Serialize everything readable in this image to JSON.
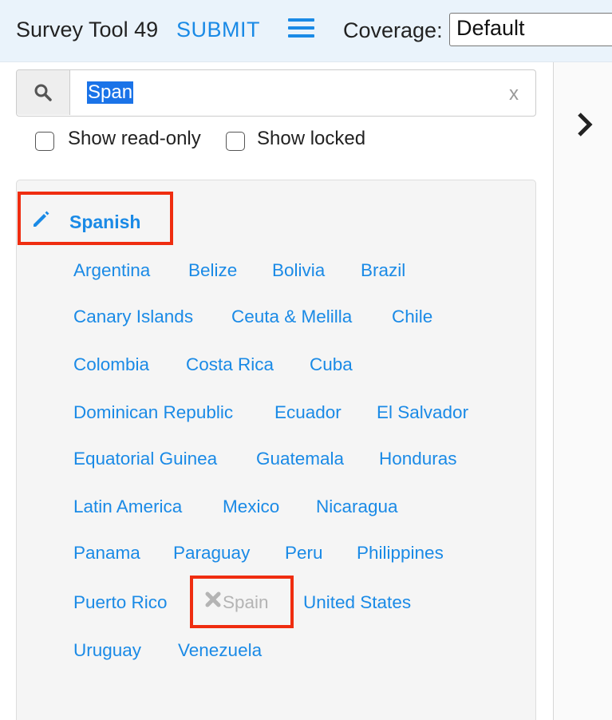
{
  "header": {
    "app_title": "Survey Tool 49",
    "submit_label": "SUBMIT",
    "coverage_label": "Coverage:",
    "coverage_value": "Default"
  },
  "search": {
    "query": "Span",
    "clear_label": "x",
    "icon": "search-icon"
  },
  "filters": {
    "show_read_only_label": "Show read-only",
    "show_read_only_checked": false,
    "show_locked_label": "Show locked",
    "show_locked_checked": false
  },
  "results": {
    "language": "Spanish",
    "language_icon": "pencil-icon",
    "regions": [
      "Argentina",
      "Belize",
      "Bolivia",
      "Brazil",
      "Canary Islands",
      "Ceuta & Melilla",
      "Chile",
      "Colombia",
      "Costa Rica",
      "Cuba",
      "Dominican Republic",
      "Ecuador",
      "El Salvador",
      "Equatorial Guinea",
      "Guatemala",
      "Honduras",
      "Latin America",
      "Mexico",
      "Nicaragua",
      "Panama",
      "Paraguay",
      "Peru",
      "Philippines",
      "Puerto Rico",
      "Spain",
      "United States",
      "Uruguay",
      "Venezuela"
    ],
    "disabled_region": "Spain",
    "disabled_icon": "x-icon"
  },
  "colors": {
    "link": "#1a8ae6",
    "highlight_border": "#ef2d10",
    "disabled_text": "#b4b4b4",
    "header_bg": "#eaf3fb",
    "selection_bg": "#1a73e8"
  },
  "side_panel": {
    "toggle_icon": "chevron-right-icon"
  }
}
